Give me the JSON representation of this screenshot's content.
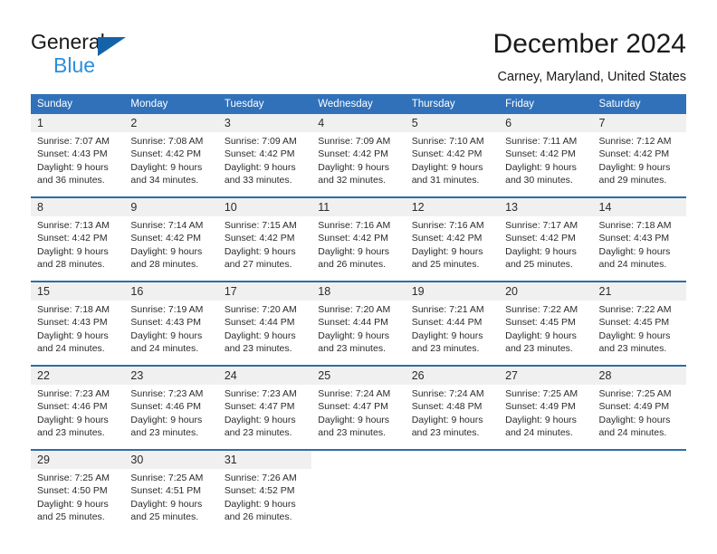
{
  "brand": {
    "name_part1": "General",
    "name_part2": "Blue",
    "logo_icon": "triangle-flag-icon"
  },
  "header": {
    "title": "December 2024",
    "subtitle": "Carney, Maryland, United States"
  },
  "colors": {
    "header_blue": "#3071b9",
    "separator_blue": "#2e6da4",
    "daynum_bg": "#f0f0f0",
    "brand_blue": "#2a8fdd",
    "logo_blue": "#1463a8"
  },
  "weekday_headers": [
    "Sunday",
    "Monday",
    "Tuesday",
    "Wednesday",
    "Thursday",
    "Friday",
    "Saturday"
  ],
  "weeks": [
    {
      "days": [
        {
          "num": "1",
          "sunrise": "Sunrise: 7:07 AM",
          "sunset": "Sunset: 4:43 PM",
          "daylight_l1": "Daylight: 9 hours",
          "daylight_l2": "and 36 minutes."
        },
        {
          "num": "2",
          "sunrise": "Sunrise: 7:08 AM",
          "sunset": "Sunset: 4:42 PM",
          "daylight_l1": "Daylight: 9 hours",
          "daylight_l2": "and 34 minutes."
        },
        {
          "num": "3",
          "sunrise": "Sunrise: 7:09 AM",
          "sunset": "Sunset: 4:42 PM",
          "daylight_l1": "Daylight: 9 hours",
          "daylight_l2": "and 33 minutes."
        },
        {
          "num": "4",
          "sunrise": "Sunrise: 7:09 AM",
          "sunset": "Sunset: 4:42 PM",
          "daylight_l1": "Daylight: 9 hours",
          "daylight_l2": "and 32 minutes."
        },
        {
          "num": "5",
          "sunrise": "Sunrise: 7:10 AM",
          "sunset": "Sunset: 4:42 PM",
          "daylight_l1": "Daylight: 9 hours",
          "daylight_l2": "and 31 minutes."
        },
        {
          "num": "6",
          "sunrise": "Sunrise: 7:11 AM",
          "sunset": "Sunset: 4:42 PM",
          "daylight_l1": "Daylight: 9 hours",
          "daylight_l2": "and 30 minutes."
        },
        {
          "num": "7",
          "sunrise": "Sunrise: 7:12 AM",
          "sunset": "Sunset: 4:42 PM",
          "daylight_l1": "Daylight: 9 hours",
          "daylight_l2": "and 29 minutes."
        }
      ]
    },
    {
      "days": [
        {
          "num": "8",
          "sunrise": "Sunrise: 7:13 AM",
          "sunset": "Sunset: 4:42 PM",
          "daylight_l1": "Daylight: 9 hours",
          "daylight_l2": "and 28 minutes."
        },
        {
          "num": "9",
          "sunrise": "Sunrise: 7:14 AM",
          "sunset": "Sunset: 4:42 PM",
          "daylight_l1": "Daylight: 9 hours",
          "daylight_l2": "and 28 minutes."
        },
        {
          "num": "10",
          "sunrise": "Sunrise: 7:15 AM",
          "sunset": "Sunset: 4:42 PM",
          "daylight_l1": "Daylight: 9 hours",
          "daylight_l2": "and 27 minutes."
        },
        {
          "num": "11",
          "sunrise": "Sunrise: 7:16 AM",
          "sunset": "Sunset: 4:42 PM",
          "daylight_l1": "Daylight: 9 hours",
          "daylight_l2": "and 26 minutes."
        },
        {
          "num": "12",
          "sunrise": "Sunrise: 7:16 AM",
          "sunset": "Sunset: 4:42 PM",
          "daylight_l1": "Daylight: 9 hours",
          "daylight_l2": "and 25 minutes."
        },
        {
          "num": "13",
          "sunrise": "Sunrise: 7:17 AM",
          "sunset": "Sunset: 4:42 PM",
          "daylight_l1": "Daylight: 9 hours",
          "daylight_l2": "and 25 minutes."
        },
        {
          "num": "14",
          "sunrise": "Sunrise: 7:18 AM",
          "sunset": "Sunset: 4:43 PM",
          "daylight_l1": "Daylight: 9 hours",
          "daylight_l2": "and 24 minutes."
        }
      ]
    },
    {
      "days": [
        {
          "num": "15",
          "sunrise": "Sunrise: 7:18 AM",
          "sunset": "Sunset: 4:43 PM",
          "daylight_l1": "Daylight: 9 hours",
          "daylight_l2": "and 24 minutes."
        },
        {
          "num": "16",
          "sunrise": "Sunrise: 7:19 AM",
          "sunset": "Sunset: 4:43 PM",
          "daylight_l1": "Daylight: 9 hours",
          "daylight_l2": "and 24 minutes."
        },
        {
          "num": "17",
          "sunrise": "Sunrise: 7:20 AM",
          "sunset": "Sunset: 4:44 PM",
          "daylight_l1": "Daylight: 9 hours",
          "daylight_l2": "and 23 minutes."
        },
        {
          "num": "18",
          "sunrise": "Sunrise: 7:20 AM",
          "sunset": "Sunset: 4:44 PM",
          "daylight_l1": "Daylight: 9 hours",
          "daylight_l2": "and 23 minutes."
        },
        {
          "num": "19",
          "sunrise": "Sunrise: 7:21 AM",
          "sunset": "Sunset: 4:44 PM",
          "daylight_l1": "Daylight: 9 hours",
          "daylight_l2": "and 23 minutes."
        },
        {
          "num": "20",
          "sunrise": "Sunrise: 7:22 AM",
          "sunset": "Sunset: 4:45 PM",
          "daylight_l1": "Daylight: 9 hours",
          "daylight_l2": "and 23 minutes."
        },
        {
          "num": "21",
          "sunrise": "Sunrise: 7:22 AM",
          "sunset": "Sunset: 4:45 PM",
          "daylight_l1": "Daylight: 9 hours",
          "daylight_l2": "and 23 minutes."
        }
      ]
    },
    {
      "days": [
        {
          "num": "22",
          "sunrise": "Sunrise: 7:23 AM",
          "sunset": "Sunset: 4:46 PM",
          "daylight_l1": "Daylight: 9 hours",
          "daylight_l2": "and 23 minutes."
        },
        {
          "num": "23",
          "sunrise": "Sunrise: 7:23 AM",
          "sunset": "Sunset: 4:46 PM",
          "daylight_l1": "Daylight: 9 hours",
          "daylight_l2": "and 23 minutes."
        },
        {
          "num": "24",
          "sunrise": "Sunrise: 7:23 AM",
          "sunset": "Sunset: 4:47 PM",
          "daylight_l1": "Daylight: 9 hours",
          "daylight_l2": "and 23 minutes."
        },
        {
          "num": "25",
          "sunrise": "Sunrise: 7:24 AM",
          "sunset": "Sunset: 4:47 PM",
          "daylight_l1": "Daylight: 9 hours",
          "daylight_l2": "and 23 minutes."
        },
        {
          "num": "26",
          "sunrise": "Sunrise: 7:24 AM",
          "sunset": "Sunset: 4:48 PM",
          "daylight_l1": "Daylight: 9 hours",
          "daylight_l2": "and 23 minutes."
        },
        {
          "num": "27",
          "sunrise": "Sunrise: 7:25 AM",
          "sunset": "Sunset: 4:49 PM",
          "daylight_l1": "Daylight: 9 hours",
          "daylight_l2": "and 24 minutes."
        },
        {
          "num": "28",
          "sunrise": "Sunrise: 7:25 AM",
          "sunset": "Sunset: 4:49 PM",
          "daylight_l1": "Daylight: 9 hours",
          "daylight_l2": "and 24 minutes."
        }
      ]
    },
    {
      "days": [
        {
          "num": "29",
          "sunrise": "Sunrise: 7:25 AM",
          "sunset": "Sunset: 4:50 PM",
          "daylight_l1": "Daylight: 9 hours",
          "daylight_l2": "and 25 minutes."
        },
        {
          "num": "30",
          "sunrise": "Sunrise: 7:25 AM",
          "sunset": "Sunset: 4:51 PM",
          "daylight_l1": "Daylight: 9 hours",
          "daylight_l2": "and 25 minutes."
        },
        {
          "num": "31",
          "sunrise": "Sunrise: 7:26 AM",
          "sunset": "Sunset: 4:52 PM",
          "daylight_l1": "Daylight: 9 hours",
          "daylight_l2": "and 26 minutes."
        },
        {
          "num": "",
          "sunrise": "",
          "sunset": "",
          "daylight_l1": "",
          "daylight_l2": ""
        },
        {
          "num": "",
          "sunrise": "",
          "sunset": "",
          "daylight_l1": "",
          "daylight_l2": ""
        },
        {
          "num": "",
          "sunrise": "",
          "sunset": "",
          "daylight_l1": "",
          "daylight_l2": ""
        },
        {
          "num": "",
          "sunrise": "",
          "sunset": "",
          "daylight_l1": "",
          "daylight_l2": ""
        }
      ]
    }
  ]
}
